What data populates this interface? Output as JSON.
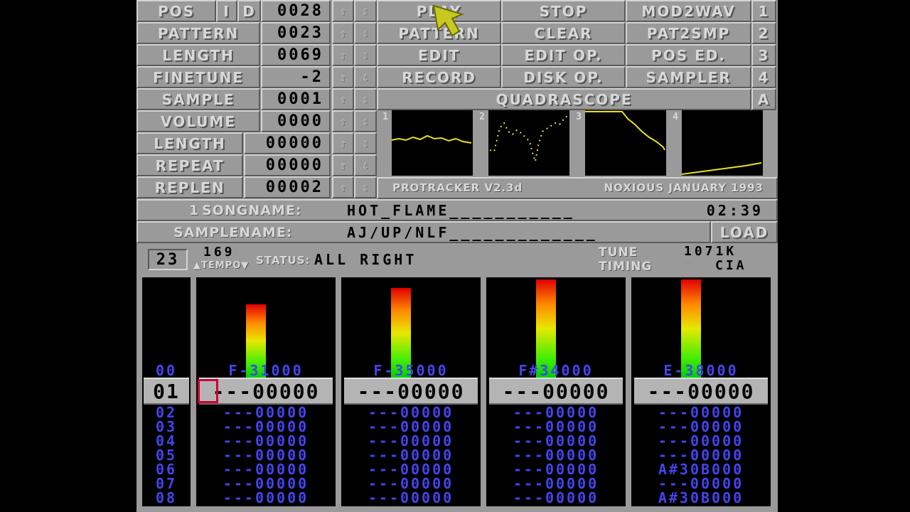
{
  "panel_rows": [
    {
      "label": "POS",
      "value": "0028"
    },
    {
      "label": "PATTERN",
      "value": "0023"
    },
    {
      "label": "LENGTH",
      "value": "0069"
    },
    {
      "label": "FINETUNE",
      "value": "-2"
    },
    {
      "label": "SAMPLE",
      "value": "0001"
    },
    {
      "label": "VOLUME",
      "value": "0000"
    },
    {
      "label": "LENGTH",
      "value": "00000"
    },
    {
      "label": "REPEAT",
      "value": "00000"
    },
    {
      "label": "REPLEN",
      "value": "00002"
    }
  ],
  "pos_ins": "I",
  "pos_del": "D",
  "arrows": {
    "up": "⇧",
    "down": "⇩"
  },
  "buttons": [
    [
      "PLAY",
      "STOP",
      "MOD2WAV",
      "1"
    ],
    [
      "PATTERN",
      "CLEAR",
      "PAT2SMP",
      "2"
    ],
    [
      "EDIT",
      "EDIT OP.",
      "POS ED.",
      "3"
    ],
    [
      "RECORD",
      "DISK OP.",
      "SAMPLER",
      "4"
    ]
  ],
  "quadrascope": {
    "label": "QUADRASCOPE",
    "key": "A",
    "channels": [
      "1",
      "2",
      "3",
      "4"
    ]
  },
  "credits": {
    "left": "PROTRACKER V2.3d",
    "right": "NOXIOUS JANUARY 1993"
  },
  "song": {
    "prefix": "1",
    "label": "SONGNAME:",
    "name": "HOT_FLAME___________",
    "time": "02:39"
  },
  "sample": {
    "label": "SAMPLENAME:",
    "name": "AJ/UP/NLF_____________",
    "load": "LOAD"
  },
  "status": {
    "pattern_num": "23",
    "tempo_value": "169",
    "tempo_label": "▲TEMPO▼",
    "status_label": "STATUS:",
    "status_text": "ALL RIGHT",
    "tune_label": "TUNE",
    "tune_value": "1071K",
    "timing_label": "TIMING",
    "timing_value": "CIA"
  },
  "tracker": {
    "rows": [
      "00",
      "01",
      "02",
      "03",
      "04",
      "05",
      "06",
      "07",
      "08"
    ],
    "current_row": "01",
    "channels": [
      {
        "vu": 0.32,
        "cells": [
          "F-31000",
          "---00000",
          "---00000",
          "---00000",
          "---00000",
          "---00000",
          "---00000",
          "---00000",
          "---00000"
        ]
      },
      {
        "vu": 0.39,
        "cells": [
          "F-35000",
          "---00000",
          "---00000",
          "---00000",
          "---00000",
          "---00000",
          "---00000",
          "---00000",
          "---00000"
        ]
      },
      {
        "vu": 0.43,
        "cells": [
          "F#34000",
          "---00000",
          "---00000",
          "---00000",
          "---00000",
          "---00000",
          "---00000",
          "---00000",
          "---00000"
        ]
      },
      {
        "vu": 0.43,
        "cells": [
          "E-38000",
          "---00000",
          "---00000",
          "---00000",
          "---00000",
          "---00000",
          "A#30B000",
          "---00000",
          "A#30B000"
        ]
      }
    ]
  },
  "colors": {
    "panel": "#9a9a9a",
    "note": "#4444ee",
    "scope": "#e8e020",
    "cursor": "#d00030"
  }
}
